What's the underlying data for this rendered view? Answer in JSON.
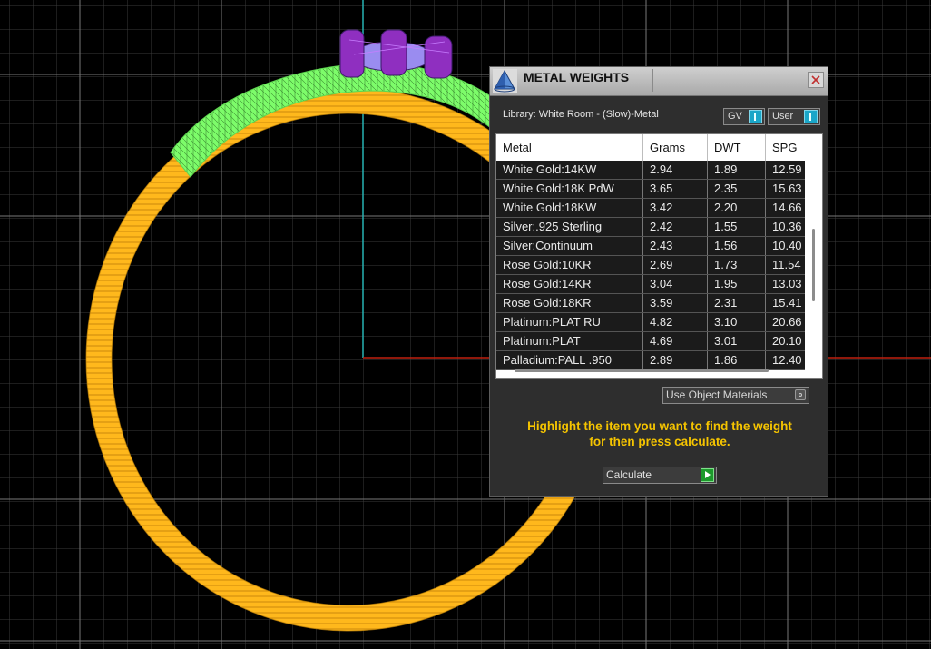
{
  "panel": {
    "title": "METAL WEIGHTS",
    "library_label": "Library: White Room - (Slow)-Metal",
    "gv_toggle_label": "GV",
    "user_toggle_label": "User",
    "use_object_materials_label": "Use Object Materials",
    "instruction_line1": "Highlight the item you want to find the weight",
    "instruction_line2": "for then press calculate.",
    "calculate_label": "Calculate"
  },
  "table": {
    "headers": [
      "Metal",
      "Grams",
      "DWT",
      "SPG"
    ],
    "rows": [
      {
        "metal": "White Gold:14KW",
        "grams": "2.94",
        "dwt": "1.89",
        "spg": "12.59"
      },
      {
        "metal": "White Gold:18K PdW",
        "grams": "3.65",
        "dwt": "2.35",
        "spg": "15.63"
      },
      {
        "metal": "White Gold:18KW",
        "grams": "3.42",
        "dwt": "2.20",
        "spg": "14.66"
      },
      {
        "metal": "Silver:.925 Sterling",
        "grams": "2.42",
        "dwt": "1.55",
        "spg": "10.36"
      },
      {
        "metal": "Silver:Continuum",
        "grams": "2.43",
        "dwt": "1.56",
        "spg": "10.40"
      },
      {
        "metal": "Rose Gold:10KR",
        "grams": "2.69",
        "dwt": "1.73",
        "spg": "11.54"
      },
      {
        "metal": "Rose Gold:14KR",
        "grams": "3.04",
        "dwt": "1.95",
        "spg": "13.03"
      },
      {
        "metal": "Rose Gold:18KR",
        "grams": "3.59",
        "dwt": "2.31",
        "spg": "15.41"
      },
      {
        "metal": "Platinum:PLAT RU",
        "grams": "4.82",
        "dwt": "3.10",
        "spg": "20.66"
      },
      {
        "metal": "Platinum:PLAT",
        "grams": "4.69",
        "dwt": "3.01",
        "spg": "20.10"
      },
      {
        "metal": "Palladium:PALL .950",
        "grams": "2.89",
        "dwt": "1.86",
        "spg": "12.40"
      }
    ]
  },
  "viewport": {
    "background": "#000000",
    "grid_color": "#6e6e6e",
    "axis_y_color": "#27b3b3",
    "axis_x_color": "#c0200f",
    "band_color": "#ffb81c",
    "head_color": "#7dfc6a",
    "gem_color": "#7a3aa8"
  }
}
